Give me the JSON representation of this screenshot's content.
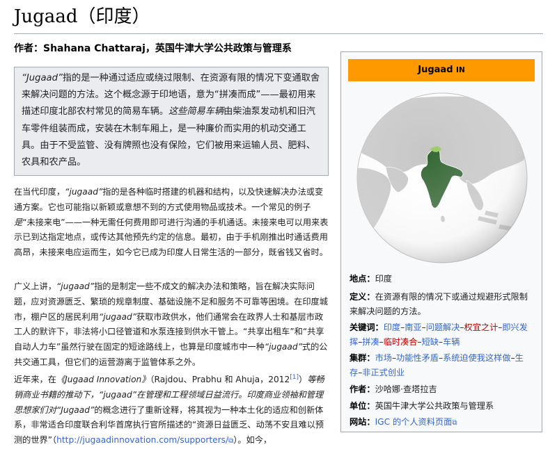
{
  "page": {
    "title": "Jugaad（印度）",
    "byline": "作者：Shahana Chattaraj，英国牛津大学公共政策与管理系"
  },
  "quote": {
    "term": "“Jugaad”",
    "text1": "指的是一种通过适应或绕过限制、在资源有限的情况下变通取舍来解决问题的方法。这个概念源于印地语，意为“拼凑而成”——最初用来描述印度北部农村常见的简易车辆。",
    "italic2": "这些简易车辆",
    "text2": "由柴油泵发动机和旧汽车零件组装而成，安装在木制车厢上，是一种廉价而实用的机动交通工具。由于不受监管、没有牌照也没有保险，它们被用来运输人员、肥料、农具和农产品。"
  },
  "para1": {
    "a": "在当代印度，",
    "term": "“jugaad”",
    "b": "指的是各种临时搭建的机器和结构，以及快速解决办法或变通方案。它也可能指以新颖或意想不到的方式使用物品或技术。一个常见的例子",
    "c": "是",
    "d": "“未接来电”——一种无需任何费用即可进行沟通的手机通话。未接来电可以用来表示已到达指定地点，或传达其他预先约定的信息。最初，由于手机刚推出时通话费用高昂，未接来电应运而生，如今它已成为印度人日常生活的一部分，既省钱又省时。"
  },
  "para2": {
    "a": "广义上讲，",
    "term": "“jugaad”",
    "b": "指的是制定一些不成文的解决办法和策略，旨在解决实际问题，应对资源匮乏、繁琐的规章制度、基础设施不足和服务不可靠等困境。在印度城市，棚户区的居民利用",
    "term2": "“jugaad”",
    "c": "获取市政供水，他们通常会在政界人士和基层市政工人的默许下，非法将小口径管道和水泵连接到供水干管上。“共享出租车”和“共享自动人力车”虽然行驶在固定的短途路线上，也算是印度城市中一种",
    "term3": "“jugaad”",
    "d": "式的公共交通工具，但它们的运营游离于监管体系之外。"
  },
  "para3": {
    "a": "近年来，在",
    "book": "《Jugaad Innovation》",
    "b": "（Rajdou、Prabhu 和 Ahuja，2012",
    "ref": "[1]",
    "c": "）",
    "i1": "等畅销商业书籍的推动下，",
    "term": "“jugaad”",
    "i2": "在管理和工程领域日益流行。印度商业领袖和管理思想家们对",
    "term2": "“Jugaad”",
    "d": "的概念进行了重新诠释，将其视为一种本土化的适应和创新体系，非常适合印度联合利华首席执行官所描述的“资源日益匮乏、动荡不安且难以预测的世界”（",
    "url": "http://jugaadinnovation.com/supporters/",
    "e": "）。如今，"
  },
  "infobox": {
    "header_main": "Jugaad",
    "header_sc": "IN",
    "location_label": "地点：",
    "location_value": "印度",
    "definition_label": "定义：",
    "definition_value": "在资源有限的情况下或通过规避形式限制来解决问题的方法。",
    "keywords_label": "关键词：",
    "keywords": [
      {
        "text": "印度",
        "color": "#3366cc"
      },
      {
        "text": "南亚",
        "color": "#3366cc"
      },
      {
        "text": "问题解决",
        "color": "#3366cc"
      },
      {
        "text": "权宜之计",
        "color": "#ba0000"
      },
      {
        "text": "即兴发挥",
        "color": "#3366cc"
      },
      {
        "text": "拼凑",
        "color": "#3366cc"
      },
      {
        "text": "临时凑合",
        "color": "#ba0000"
      },
      {
        "text": "短缺",
        "color": "#3366cc"
      },
      {
        "text": "车辆",
        "color": "#3366cc"
      }
    ],
    "clusters_label": "集群：",
    "clusters": [
      {
        "text": "市场",
        "color": "#3366cc"
      },
      {
        "text": "功能性矛盾",
        "color": "#3366cc"
      },
      {
        "text": "系统迫使我这样做",
        "color": "#3366cc"
      },
      {
        "text": "生存",
        "color": "#3366cc"
      },
      {
        "text": "非正式创业",
        "color": "#3366cc"
      }
    ],
    "author_label": "作者：",
    "author_value": "沙哈娜·查塔拉吉",
    "unit_label": "单位：",
    "unit_value": "英国牛津大学公共政策与管理系",
    "site_label": "网站：",
    "site_value": "IGC 的个人资料页面",
    "colors": {
      "header": "#ff9900",
      "india": "#336633",
      "land": "#c6c6c6",
      "ocean": "#ffffff"
    }
  }
}
